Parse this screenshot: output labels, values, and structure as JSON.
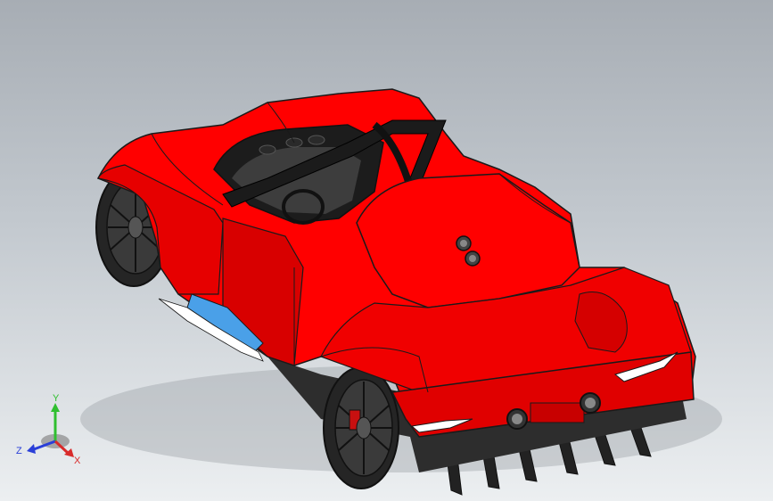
{
  "viewport": {
    "background_top": "#a7adb4",
    "background_bottom": "#eceff1"
  },
  "model": {
    "body_color": "#ff0000",
    "body_shadow_color": "#c40000",
    "edge_color": "#1a1a1a",
    "tire_color": "#2a2a2a",
    "rim_color": "#3a3a3a",
    "accent_color": "#4aa0e8"
  },
  "triad": {
    "y_label": "Y",
    "z_label": "Z",
    "x_label": "X",
    "y_color": "#2fbf2f",
    "z_color": "#2a3fd8",
    "x_color": "#d82a2a"
  }
}
